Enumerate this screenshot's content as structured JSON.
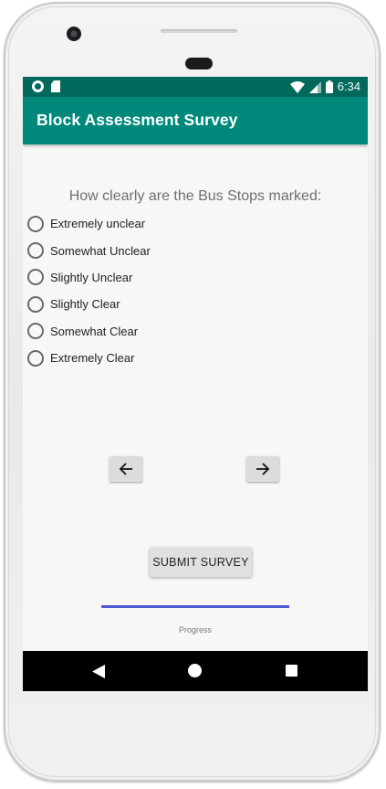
{
  "status_bar": {
    "time": "6:34"
  },
  "app_bar": {
    "title": "Block Assessment Survey"
  },
  "question": {
    "text": "How clearly are the Bus Stops marked:",
    "options": [
      "Extremely unclear",
      "Somewhat Unclear",
      "Slightly Unclear",
      "Slightly Clear",
      "Somewhat Clear",
      "Extremely Clear"
    ]
  },
  "navigation": {
    "prev_icon": "arrow-left-icon",
    "next_icon": "arrow-right-icon"
  },
  "submit": {
    "label": "SUBMIT SURVEY"
  },
  "progress": {
    "label": "Progress",
    "value": 1.0
  },
  "system_nav": {
    "back_icon": "back-icon",
    "home_icon": "home-icon",
    "recents_icon": "recents-icon"
  },
  "colors": {
    "status_bar": "#00695c",
    "app_bar": "#00897b",
    "progress": "#4f5bd5"
  }
}
